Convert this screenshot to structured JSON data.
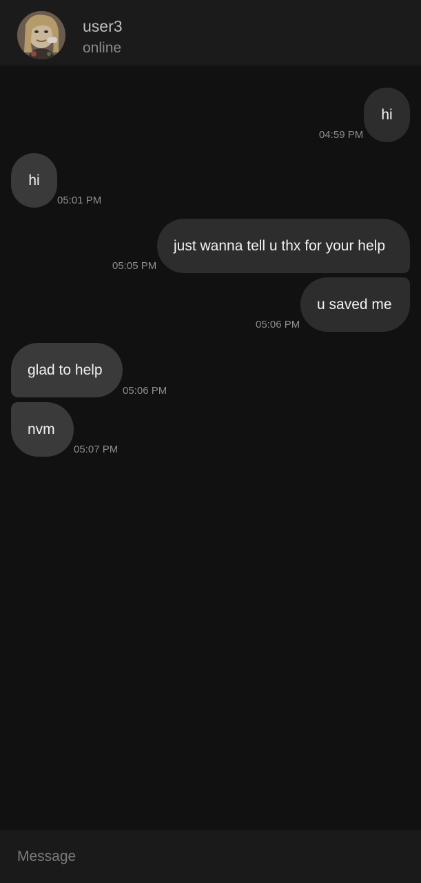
{
  "header": {
    "name": "user3",
    "status": "online"
  },
  "messages": [
    {
      "side": "mine",
      "text": "hi",
      "time": "04:59 PM"
    },
    {
      "side": "theirs",
      "text": "hi",
      "time": "05:01 PM"
    },
    {
      "side": "mine",
      "text": "just wanna tell u thx for your help",
      "time": "05:05 PM"
    },
    {
      "side": "mine",
      "text": "u saved me",
      "time": "05:06 PM"
    },
    {
      "side": "theirs",
      "text": "glad to help",
      "time": "05:06 PM"
    },
    {
      "side": "theirs",
      "text": "nvm",
      "time": "05:07 PM"
    }
  ],
  "composer": {
    "placeholder": "Message"
  },
  "colors": {
    "background": "#111111",
    "header": "#1b1b1b",
    "bubble_mine": "#2d2d2d",
    "bubble_theirs": "#3a3a3a"
  }
}
